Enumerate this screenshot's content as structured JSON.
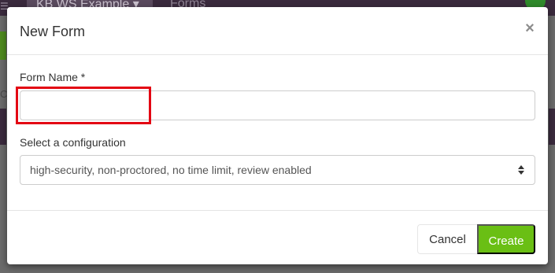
{
  "background": {
    "workspace_dropdown_label": "KB WS Example",
    "nav_forms_label": "Forms",
    "left_partial_text": "Co"
  },
  "modal": {
    "title": "New Form",
    "close_symbol": "×",
    "form_name": {
      "label": "Form Name *",
      "value": "",
      "placeholder": ""
    },
    "configuration": {
      "label": "Select a configuration",
      "selected": "high-security, non-proctored, no time limit, review enabled"
    },
    "footer": {
      "cancel_label": "Cancel",
      "create_label": "Create"
    }
  },
  "colors": {
    "accent_green": "#6abf14",
    "highlight_red": "#e30613",
    "topbar_purple": "#3a2a3d"
  },
  "icons": [
    "menu-icon",
    "caret-down-icon",
    "user-icon",
    "close-icon",
    "select-arrows-icon"
  ]
}
